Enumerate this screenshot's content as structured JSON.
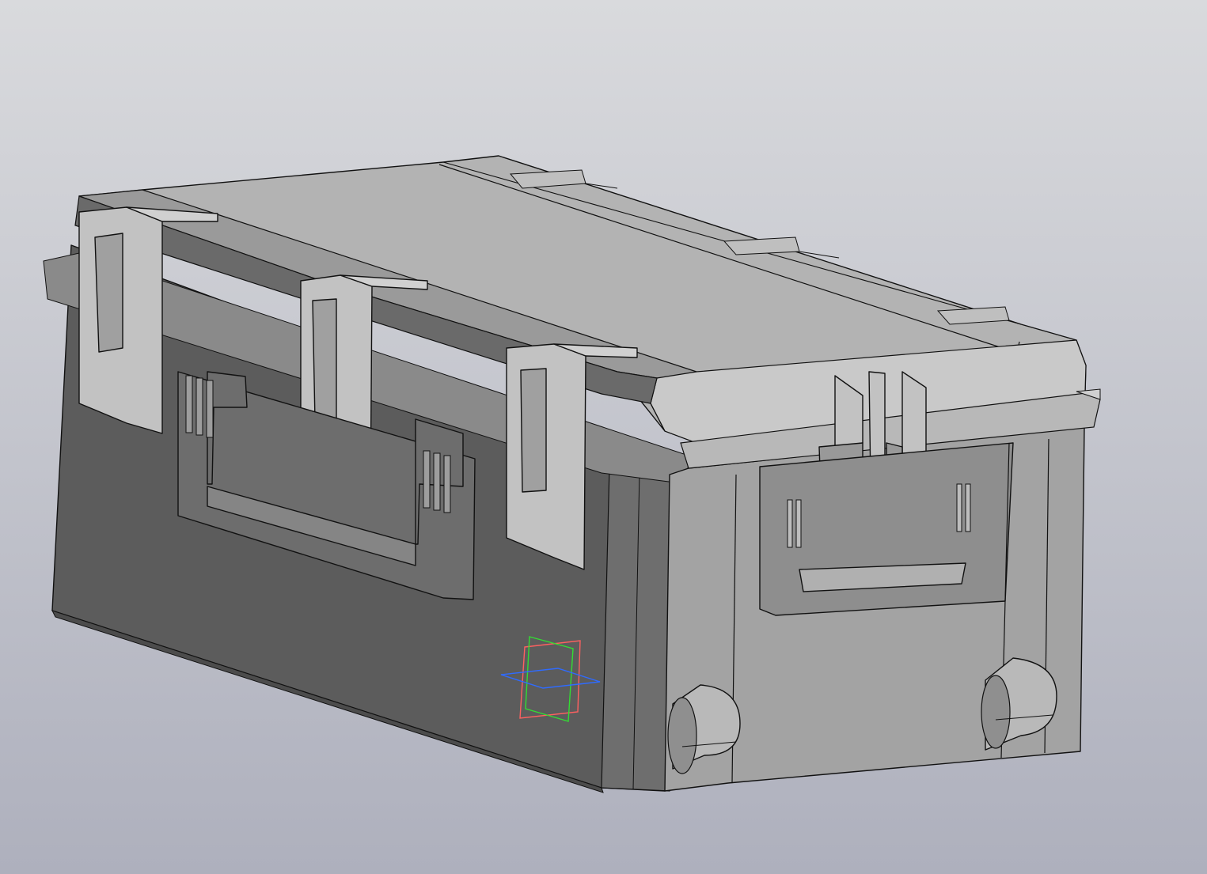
{
  "viewport": {
    "background_top": "#d9dadd",
    "background_bottom": "#aeb0bd"
  },
  "model": {
    "object": "hard-shell case",
    "colors": {
      "top_face": "#b3b3b3",
      "front_face": "#5c5c5c",
      "end_face": "#a3a3a3",
      "latch": "#c2c2c2",
      "highlight": "#d6d6d6",
      "edge": "#111111"
    }
  },
  "triad": {
    "x_plane_color": "#ff6060",
    "y_plane_color": "#33dd33",
    "z_plane_color": "#2f6bff"
  }
}
